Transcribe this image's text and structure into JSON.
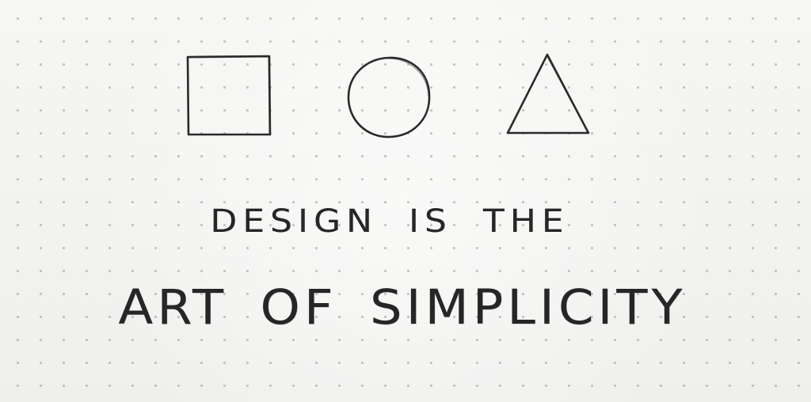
{
  "note": {
    "line_1": "DESIGN IS THE",
    "line_2": "ART OF SIMPLICITY"
  },
  "sketch": {
    "shapes": [
      "square",
      "circle",
      "triangle"
    ],
    "ink_color": "#262626",
    "paper_color": "#f3f3f1",
    "dot_color": "#969696"
  }
}
